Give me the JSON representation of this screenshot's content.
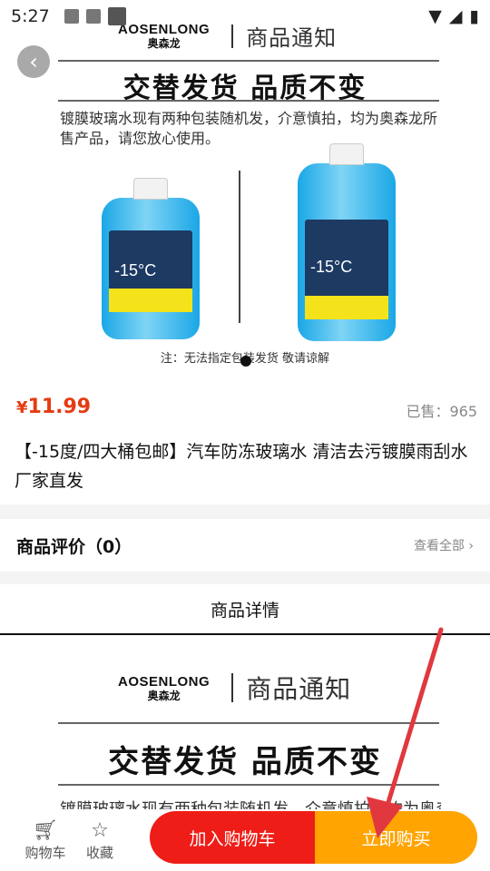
{
  "status_bar": {
    "time": "5:27"
  },
  "hero": {
    "brand_en": "AOSENLONG",
    "brand_cn": "奥森龙",
    "brand_title": "商品通知",
    "headline": "交替发货  品质不变",
    "description": "镀膜玻璃水现有两种包装随机发，介意慎拍，均为奥森龙所售产品，请您放心使用。",
    "bottle_text": "-15°C",
    "note": "注：无法指定包装发货  敬请谅解"
  },
  "product": {
    "currency": "¥",
    "price": "11.99",
    "sold": "已售：965",
    "title": "【-15度/四大桶包邮】汽车防冻玻璃水 清洁去污镀膜雨刮水 厂家直发"
  },
  "review": {
    "label": "商品评价（0）",
    "more": "查看全部 ›"
  },
  "detail_tab": "商品详情",
  "bottom_bar": {
    "cart_label": "购物车",
    "favorite_label": "收藏",
    "add_to_cart": "加入购物车",
    "buy_now": "立即购买"
  },
  "colors": {
    "price": "#e53b12",
    "add_to_cart": "#ef1d17",
    "buy_now": "#ffa400",
    "annotation_arrow": "#e0383e"
  }
}
